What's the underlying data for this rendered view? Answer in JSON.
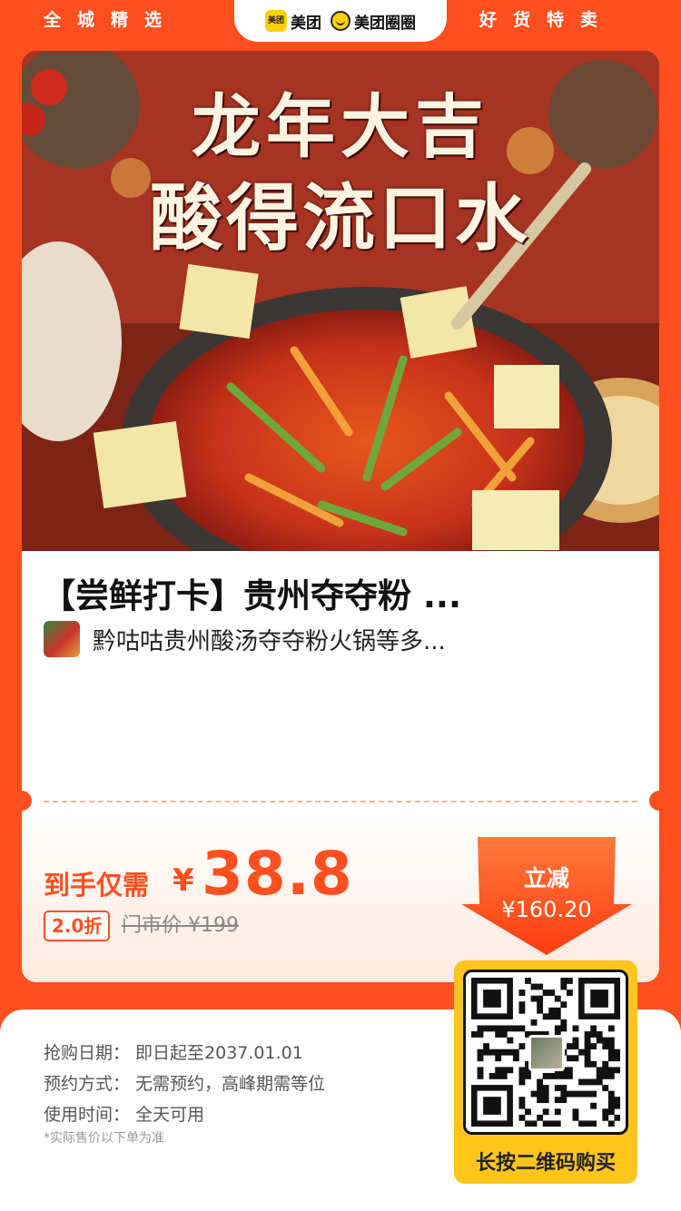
{
  "header": {
    "left_text": "全城精选",
    "right_text": "好货特卖",
    "brand_logo_text": "美团",
    "brand_meituan": "美团",
    "brand_quanquan": "美团圈圈"
  },
  "hero": {
    "line1": "龙年大吉",
    "line2": "酸得流口水",
    "image_icon": "hotpot-photo"
  },
  "deal": {
    "title": "【尝鲜打卡】贵州夺夺粉 ...",
    "shop_name": "黔咕咕贵州酸汤夺夺粉火锅等多..."
  },
  "price": {
    "label": "到手仅需",
    "currency": "¥",
    "value": "38.8",
    "discount_badge": "2.0折",
    "original": "门市价 ¥199",
    "save_label": "立减",
    "save_amount": "¥160.20"
  },
  "info": {
    "rows": [
      {
        "k": "抢购日期：",
        "v": "即日起至2037.01.01"
      },
      {
        "k": "预约方式：",
        "v": "无需预约，高峰期需等位"
      },
      {
        "k": "使用时间：",
        "v": "全天可用"
      }
    ],
    "note": "*实际售价以下单为准"
  },
  "qr": {
    "caption": "长按二维码购买"
  },
  "colors": {
    "accent": "#ff4f1f",
    "qr_frame": "#ffc51b"
  }
}
